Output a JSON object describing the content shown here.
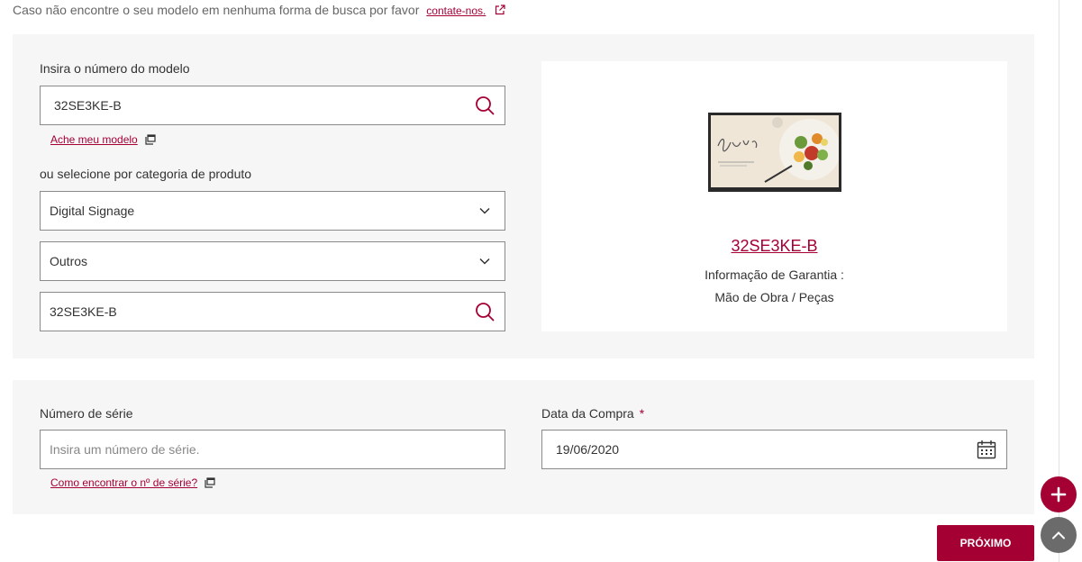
{
  "notice": {
    "text": "Caso não encontre o seu modelo em nenhuma forma de busca por favor",
    "link": "contate-nos."
  },
  "model_section": {
    "model_label": "Insira o número do modelo",
    "model_value": "32SE3KE-B",
    "find_model_link": "Ache meu modelo",
    "category_label": "ou selecione por categoria de produto",
    "category_select": "Digital Signage",
    "subcategory_select": "Outros",
    "model_search_value": "32SE3KE-B"
  },
  "product": {
    "name": "32SE3KE-B",
    "warranty_label": "Informação de Garantia :",
    "warranty_value": "Mão de Obra / Peças"
  },
  "serial_section": {
    "serial_label": "Número de série",
    "serial_placeholder": "Insira um número de série.",
    "serial_help_link": "Como encontrar o nº de série?",
    "date_label": "Data da Compra",
    "required_mark": "*",
    "date_value": "19/06/2020"
  },
  "actions": {
    "next_label": "PRÓXIMO"
  },
  "colors": {
    "brand": "#a50034",
    "panel": "#f6f6f6"
  },
  "icons": [
    "external-link-icon",
    "search-icon",
    "window-icon",
    "chevron-down-icon",
    "calendar-icon",
    "plus-icon",
    "chevron-up-icon"
  ]
}
